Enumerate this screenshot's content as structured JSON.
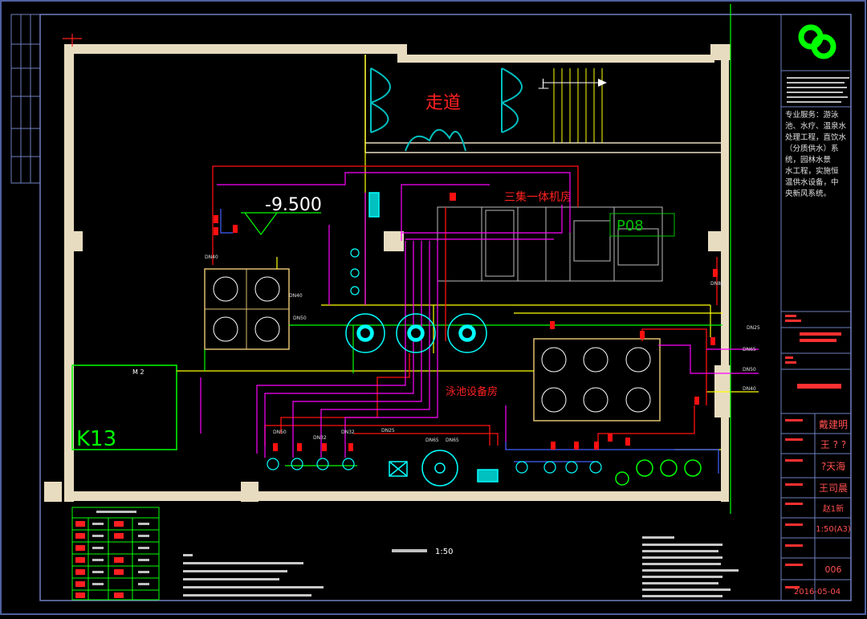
{
  "drawing": {
    "level_label": "-9.500",
    "corridor_label": "走道",
    "room_unit_label": "三集一体机房",
    "equipment_room_label": "泳池设备房",
    "k13_label": "K13",
    "p08_label": "P08",
    "up_label": "上",
    "scale_title": "1:50",
    "m2_label": "M 2",
    "pipe_tags": [
      "DN40",
      "DN50",
      "DN25",
      "DN32",
      "DN65",
      "DN80"
    ]
  },
  "title_block": {
    "company_blurb": [
      "专业服务：游泳",
      "池、水疗、温泉水",
      "处理工程，直饮水",
      "（分质供水）系",
      "统，园林水景",
      "水工程，实施恒",
      "温供水设备，中",
      "央新风系统。"
    ],
    "designer": "戴建明",
    "drafter": "王 ? ?",
    "checker": "?天海",
    "approver": "王司晨",
    "reviewer": "赵1新",
    "scale": "1:50(A3)",
    "sheet": "006",
    "date": "2016-05-04"
  },
  "colors": {
    "bg": "#000000",
    "wall": "#e8dcc0",
    "magenta": "#ff00ff",
    "cyan": "#00ffff",
    "green": "#00ff00",
    "yellow": "#ffff00",
    "red": "#ff0000",
    "blue": "#4060ff",
    "white": "#ffffff",
    "frame": "#7080c0"
  }
}
